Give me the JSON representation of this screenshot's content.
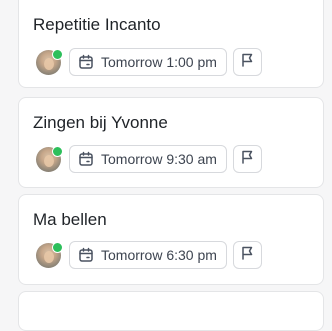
{
  "tasks": [
    {
      "title": "Repetitie Incanto",
      "due_label": "Tomorrow 1:00 pm",
      "assignee_online": true
    },
    {
      "title": "Zingen bij Yvonne",
      "due_label": "Tomorrow 9:30 am",
      "assignee_online": true
    },
    {
      "title": "Ma bellen",
      "due_label": "Tomorrow 6:30 pm",
      "assignee_online": true
    }
  ],
  "icons": {
    "due_date": "calendar-icon",
    "priority": "flag-icon",
    "presence": "online-status-dot"
  },
  "colors": {
    "online": "#2dbf5b",
    "card_border": "#e4e5e7",
    "text_primary": "#1f2328",
    "text_secondary": "#3d4450"
  }
}
